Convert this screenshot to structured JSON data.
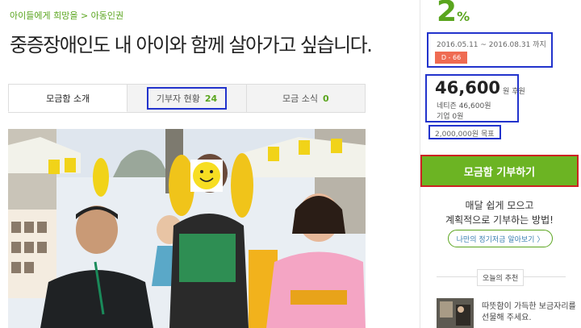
{
  "breadcrumb": "아이들에게 희망을 > 아동인권",
  "title": "중증장애인도 내 아이와 함께 살아가고 싶습니다.",
  "tabs": [
    {
      "label": "모금함 소개",
      "count": ""
    },
    {
      "label": "기부자 현황",
      "count": "24"
    },
    {
      "label": "모금 소식",
      "count": "0"
    }
  ],
  "sidebar": {
    "progress_value": "2",
    "progress_unit": "%",
    "period": "2016.05.11 ~ 2016.08.31 까지",
    "dday": "D - 66",
    "amount": "46,600",
    "amount_unit": "원 후원",
    "netizen": "네티즌 46,600원",
    "company": "기업 0원",
    "goal": "2,000,000원 목표",
    "donate_button": "모금함 기부하기",
    "promo_line1": "매달 쉽게 모으고",
    "promo_line2": "계획적으로 기부하는 방법!",
    "promo_button": "나만의 정기저금 알아보기 〉",
    "recommend_label": "오늘의 추천",
    "recommend_text": "따뜻함이 가득한 보금자리를 선물해 주세요."
  },
  "colors": {
    "accent_green": "#5aa51e",
    "button_green": "#6cb423",
    "dday_red": "#ef6b52",
    "annotation_blue": "#2233cc",
    "annotation_red": "#cc2222"
  }
}
